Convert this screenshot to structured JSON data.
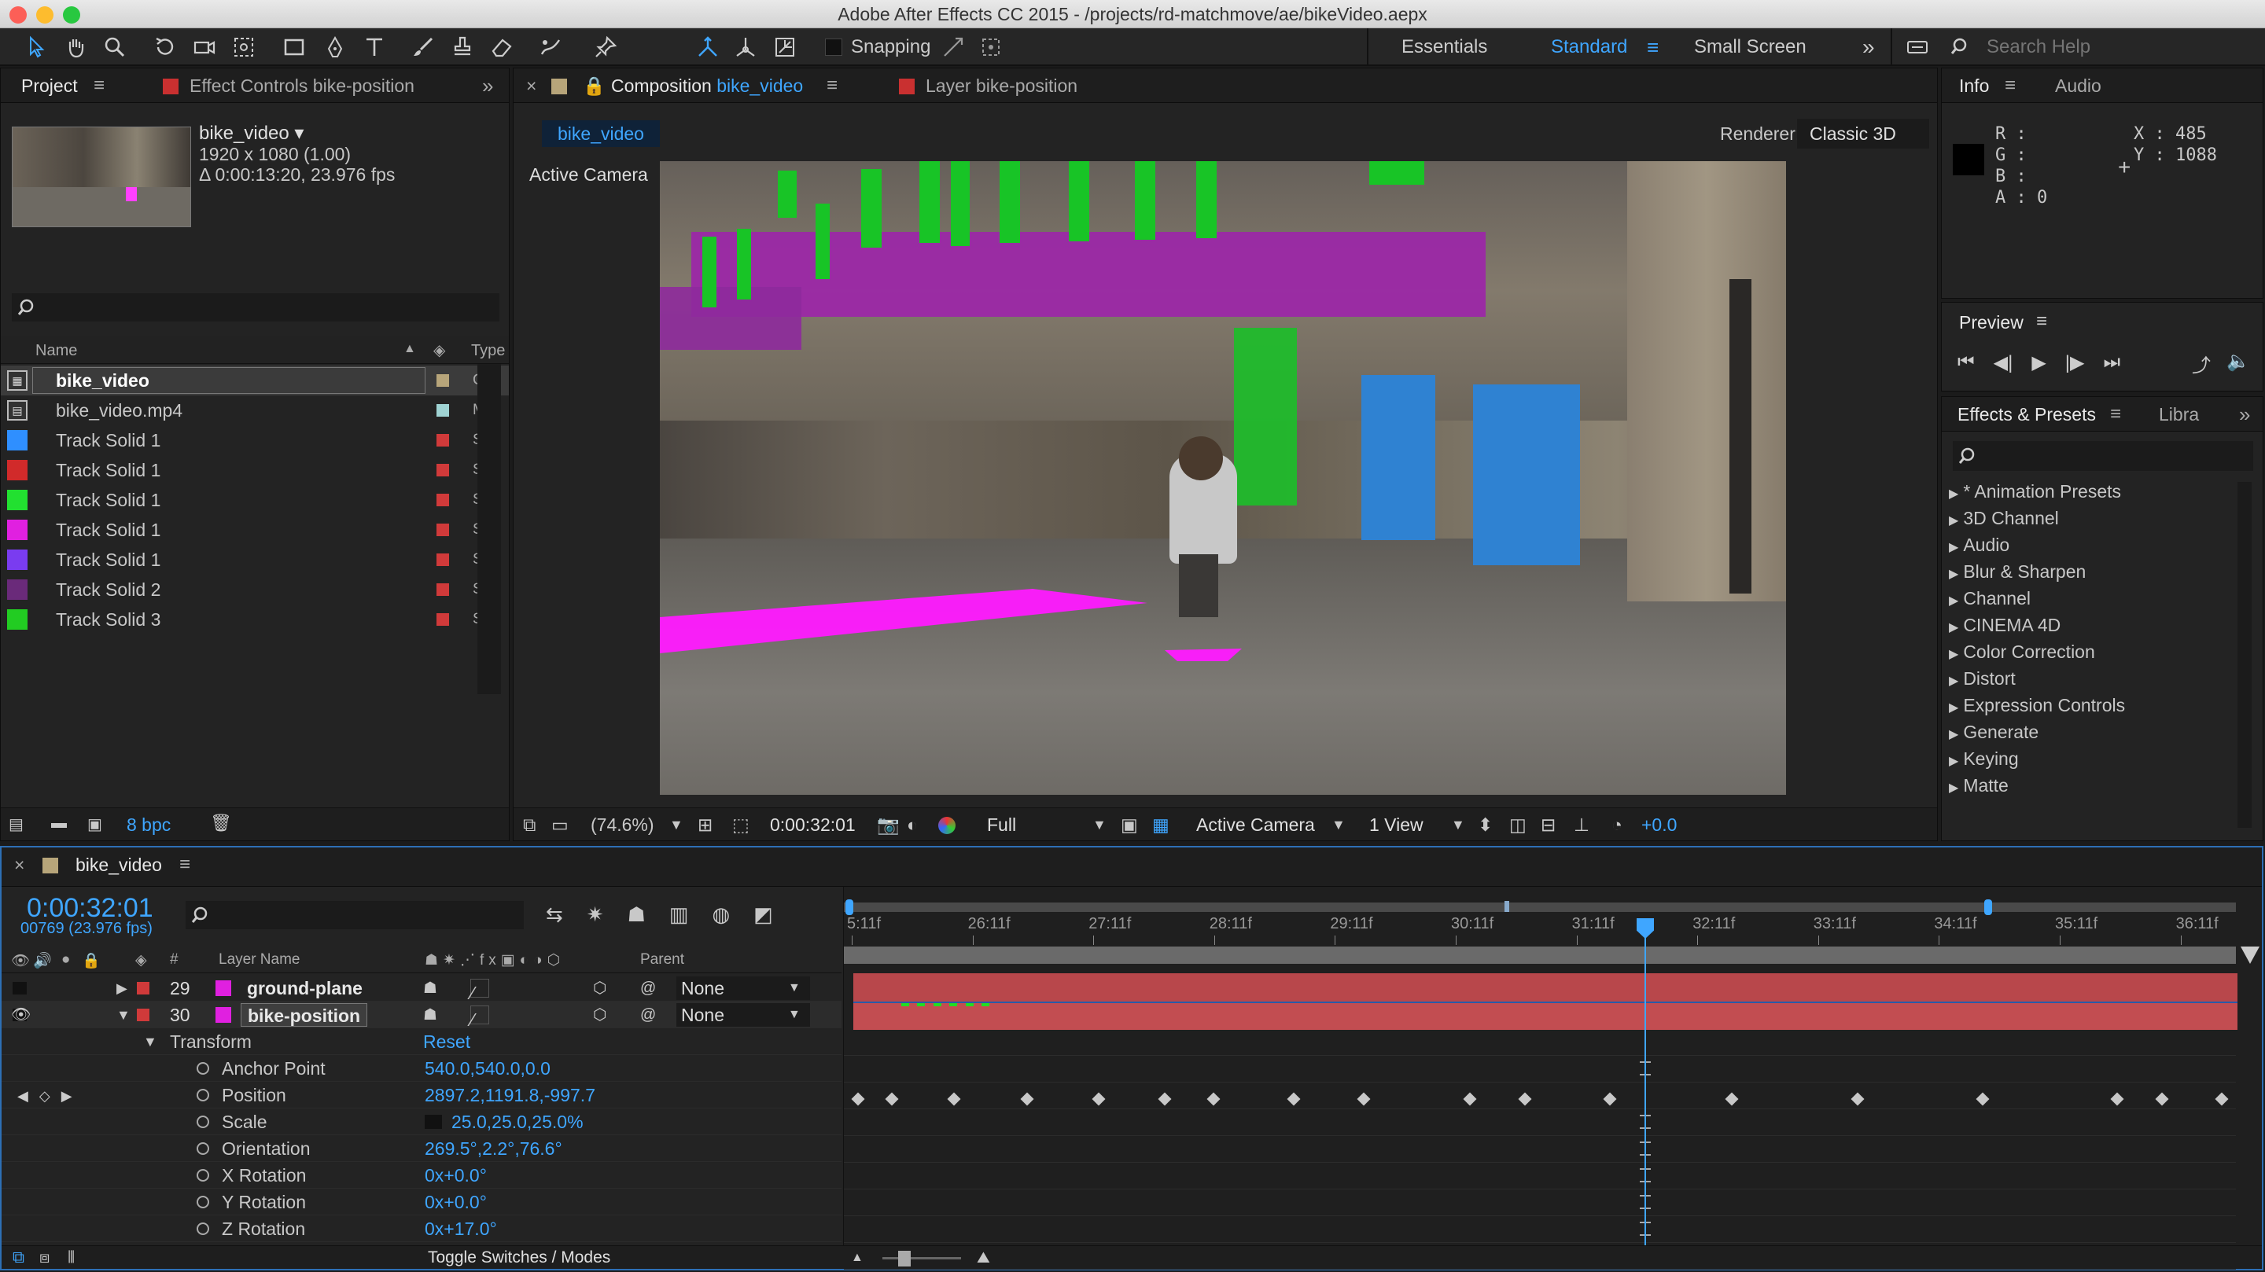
{
  "window": {
    "title": "Adobe After Effects CC 2015 - /projects/rd-matchmove/ae/bikeVideo.aepx"
  },
  "toolbar": {
    "snapping_label": "Snapping",
    "workspaces": [
      "Essentials",
      "Standard",
      "Small Screen"
    ],
    "active_workspace": "Standard",
    "search_placeholder": "Search Help"
  },
  "project_panel": {
    "tabs": [
      "Project",
      "Effect Controls bike-position"
    ],
    "selected_name": "bike_video ▾",
    "selected_dims": "1920 x 1080 (1.00)",
    "selected_duration": "Δ 0:00:13:20, 23.976 fps",
    "col_name": "Name",
    "col_type": "Type",
    "bpc": "8 bpc",
    "items": [
      {
        "name": "bike_video",
        "icon": "composition-icon",
        "label_color": "#b7a57a",
        "type": "C",
        "selected": true
      },
      {
        "name": "bike_video.mp4",
        "icon": "footage-icon",
        "label_color": "#9fd3d3",
        "type": "M"
      },
      {
        "name": "Track Solid 1",
        "color": "#2f8fff",
        "label_color": "#d03a3a",
        "type": "S"
      },
      {
        "name": "Track Solid 1",
        "color": "#d12a2a",
        "label_color": "#d03a3a",
        "type": "S"
      },
      {
        "name": "Track Solid 1",
        "color": "#22e030",
        "label_color": "#d03a3a",
        "type": "S"
      },
      {
        "name": "Track Solid 1",
        "color": "#e020e0",
        "label_color": "#d03a3a",
        "type": "S"
      },
      {
        "name": "Track Solid 1",
        "color": "#7a3cf0",
        "label_color": "#d03a3a",
        "type": "S"
      },
      {
        "name": "Track Solid 2",
        "color": "#6a2a7a",
        "label_color": "#d03a3a",
        "type": "S"
      },
      {
        "name": "Track Solid 3",
        "color": "#22cc22",
        "label_color": "#d03a3a",
        "type": "S"
      }
    ]
  },
  "comp_panel": {
    "tabs": [
      "Composition bike_video",
      "Layer bike-position"
    ],
    "comp_prefix": "Composition",
    "comp_name": "bike_video",
    "layer_tab": "Layer bike-position",
    "breadcrumb": "bike_video",
    "renderer_label": "Renderer:",
    "renderer_value": "Classic 3D",
    "view_label": "Active Camera",
    "zoom": "(74.6%)",
    "timecode": "0:00:32:01",
    "resolution": "Full",
    "camera": "Active Camera",
    "views": "1 View",
    "exposure": "+0.0"
  },
  "info_panel": {
    "tabs": [
      "Info",
      "Audio"
    ],
    "r": "R :",
    "g": "G :",
    "b": "B :",
    "a": "A : 0",
    "x": "X : 485",
    "y": "Y : 1088"
  },
  "preview_panel": {
    "title": "Preview"
  },
  "effects_panel": {
    "tabs": [
      "Effects & Presets",
      "Libra"
    ],
    "items": [
      "* Animation Presets",
      "3D Channel",
      "Audio",
      "Blur & Sharpen",
      "Channel",
      "CINEMA 4D",
      "Color Correction",
      "Distort",
      "Expression Controls",
      "Generate",
      "Keying",
      "Matte"
    ]
  },
  "timeline": {
    "tab": "bike_video",
    "timecode": "0:00:32:01",
    "frames": "00769 (23.976 fps)",
    "ruler": [
      "5:11f",
      "26:11f",
      "27:11f",
      "28:11f",
      "29:11f",
      "30:11f",
      "31:11f",
      "32:11f",
      "33:11f",
      "34:11f",
      "35:11f",
      "36:11f"
    ],
    "col_num": "#",
    "col_layer": "Layer Name",
    "col_parent": "Parent",
    "layers": [
      {
        "num": "29",
        "name": "ground-plane",
        "color": "#e020e0",
        "parent": "None"
      },
      {
        "num": "30",
        "name": "bike-position",
        "color": "#e020e0",
        "parent": "None",
        "selected": true
      }
    ],
    "transform_label": "Transform",
    "reset_label": "Reset",
    "properties": [
      {
        "name": "Anchor Point",
        "value": "540.0,540.0,0.0"
      },
      {
        "name": "Position",
        "value": "2897.2,1191.8,-997.7"
      },
      {
        "name": "Scale",
        "value": "25.0,25.0,25.0%"
      },
      {
        "name": "Orientation",
        "value": "269.5°,2.2°,76.6°"
      },
      {
        "name": "X Rotation",
        "value": "0x+0.0°"
      },
      {
        "name": "Y Rotation",
        "value": "0x+0.0°"
      },
      {
        "name": "Z Rotation",
        "value": "0x+17.0°"
      }
    ],
    "toggle_label": "Toggle Switches / Modes"
  },
  "colors": {
    "accent": "#3fa6ff",
    "layer_bar": "#b8474b",
    "magenta": "#ff1aff"
  }
}
